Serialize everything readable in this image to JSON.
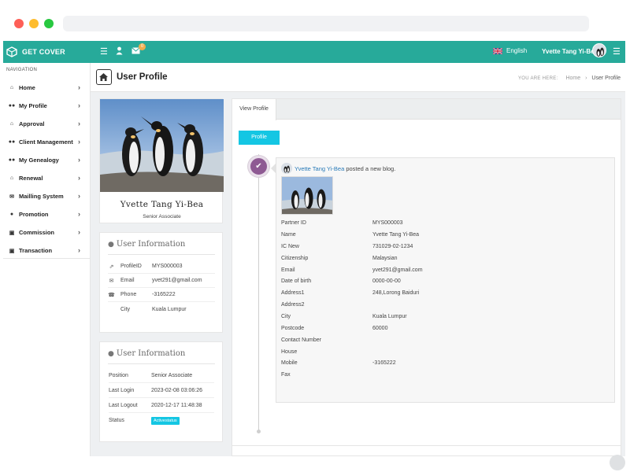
{
  "brand": {
    "name": "GET COVER"
  },
  "topbar": {
    "notification_count": "0",
    "language": "English",
    "user_name": "Yvette Tang Yi-Bea",
    "icons": [
      "menu-icon",
      "user-icon",
      "envelope-icon",
      "hamburger-icon"
    ]
  },
  "sidebar": {
    "heading": "NAVIGATION",
    "items": [
      {
        "label": "Home",
        "icon": "home-icon"
      },
      {
        "label": "My Profile",
        "icon": "users-icon"
      },
      {
        "label": "Approval",
        "icon": "home-icon"
      },
      {
        "label": "Client Management",
        "icon": "users-icon"
      },
      {
        "label": "My Genealogy",
        "icon": "users-icon"
      },
      {
        "label": "Renewal",
        "icon": "home-icon"
      },
      {
        "label": "Mailling System",
        "icon": "envelope-icon"
      },
      {
        "label": "Promotion",
        "icon": "user-icon"
      },
      {
        "label": "Commission",
        "icon": "money-icon"
      },
      {
        "label": "Transaction",
        "icon": "money-icon"
      }
    ]
  },
  "page": {
    "title": "User Profile",
    "breadcrumb_prefix": "YOU ARE HERE:",
    "breadcrumb_home": "Home",
    "breadcrumb_current": "User Profile"
  },
  "profile": {
    "name": "Yvette Tang Yi-Bea",
    "role": "Senior Associate"
  },
  "user_info_1": {
    "title": "User Information",
    "rows": [
      {
        "icon": "external-link-icon",
        "label": "ProfileID",
        "value": "MYS000003"
      },
      {
        "icon": "envelope-icon",
        "label": "Email",
        "value": "yvet291@gmail.com"
      },
      {
        "icon": "phone-icon",
        "label": "Phone",
        "value": "-3165222"
      },
      {
        "icon": "",
        "label": "City",
        "value": "Kuala Lumpur"
      }
    ]
  },
  "user_info_2": {
    "title": "User Information",
    "rows": [
      {
        "label": "Position",
        "value": "Senior Associate"
      },
      {
        "label": "Last Login",
        "value": "2023-02-08 03:06:26"
      },
      {
        "label": "Last Logout",
        "value": "2020-12-17 11:48:38"
      },
      {
        "label": "Status",
        "value": "Activestatus"
      }
    ]
  },
  "panel": {
    "tab_label": "View Profile",
    "section_label": "Profile",
    "post_author": "Yvette Tang Yi-Bea",
    "post_action": " posted a new blog.",
    "details": [
      {
        "label": "Partner ID",
        "value": "MYS000003"
      },
      {
        "label": "Name",
        "value": "Yvette Tang Yi-Bea"
      },
      {
        "label": "IC New",
        "value": "731029-02-1234"
      },
      {
        "label": "Citizenship",
        "value": "Malaysian"
      },
      {
        "label": "Email",
        "value": "yvet291@gmail.com"
      },
      {
        "label": "Date of birth",
        "value": "0000-00-00"
      },
      {
        "label": "Address1",
        "value": "248,Lorong Baiduri"
      },
      {
        "label": "Address2",
        "value": ""
      },
      {
        "label": "City",
        "value": "Kuala Lumpur"
      },
      {
        "label": "Postcode",
        "value": "60000"
      },
      {
        "label": "Contact Number",
        "value": ""
      },
      {
        "label": "House",
        "value": ""
      },
      {
        "label": "Mobile",
        "value": "-3165222"
      },
      {
        "label": "Fax",
        "value": ""
      }
    ]
  },
  "colors": {
    "topbar": "#27aa9a",
    "accent_cyan": "#14c6e3",
    "timeline_purple": "#8e5a93",
    "link_blue": "#2a7bb8"
  }
}
